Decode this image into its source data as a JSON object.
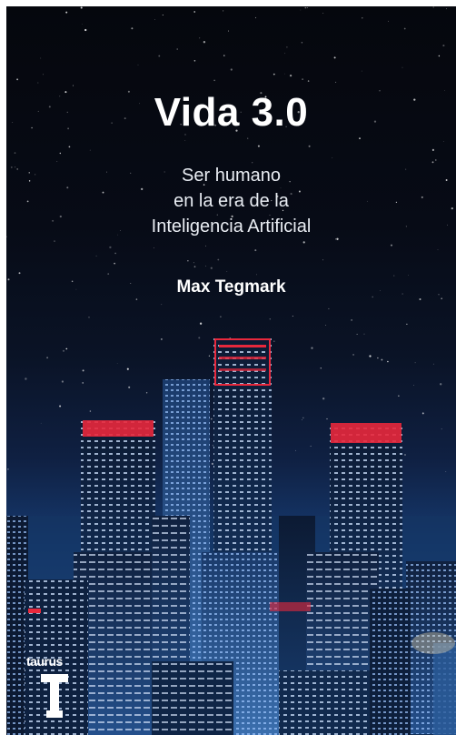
{
  "book": {
    "title": "Vida 3.0",
    "subtitle_lines": [
      "Ser humano",
      "en la era de la",
      "Inteligencia Artificial"
    ],
    "author": "Max Tegmark",
    "publisher": "taurus",
    "publisher_logo_letter": "T"
  },
  "colors": {
    "sky_top": "#05070d",
    "city_glow": "#1d4a86",
    "rooftop_red": "#e8283c",
    "window_light": "#cfe2ff"
  }
}
